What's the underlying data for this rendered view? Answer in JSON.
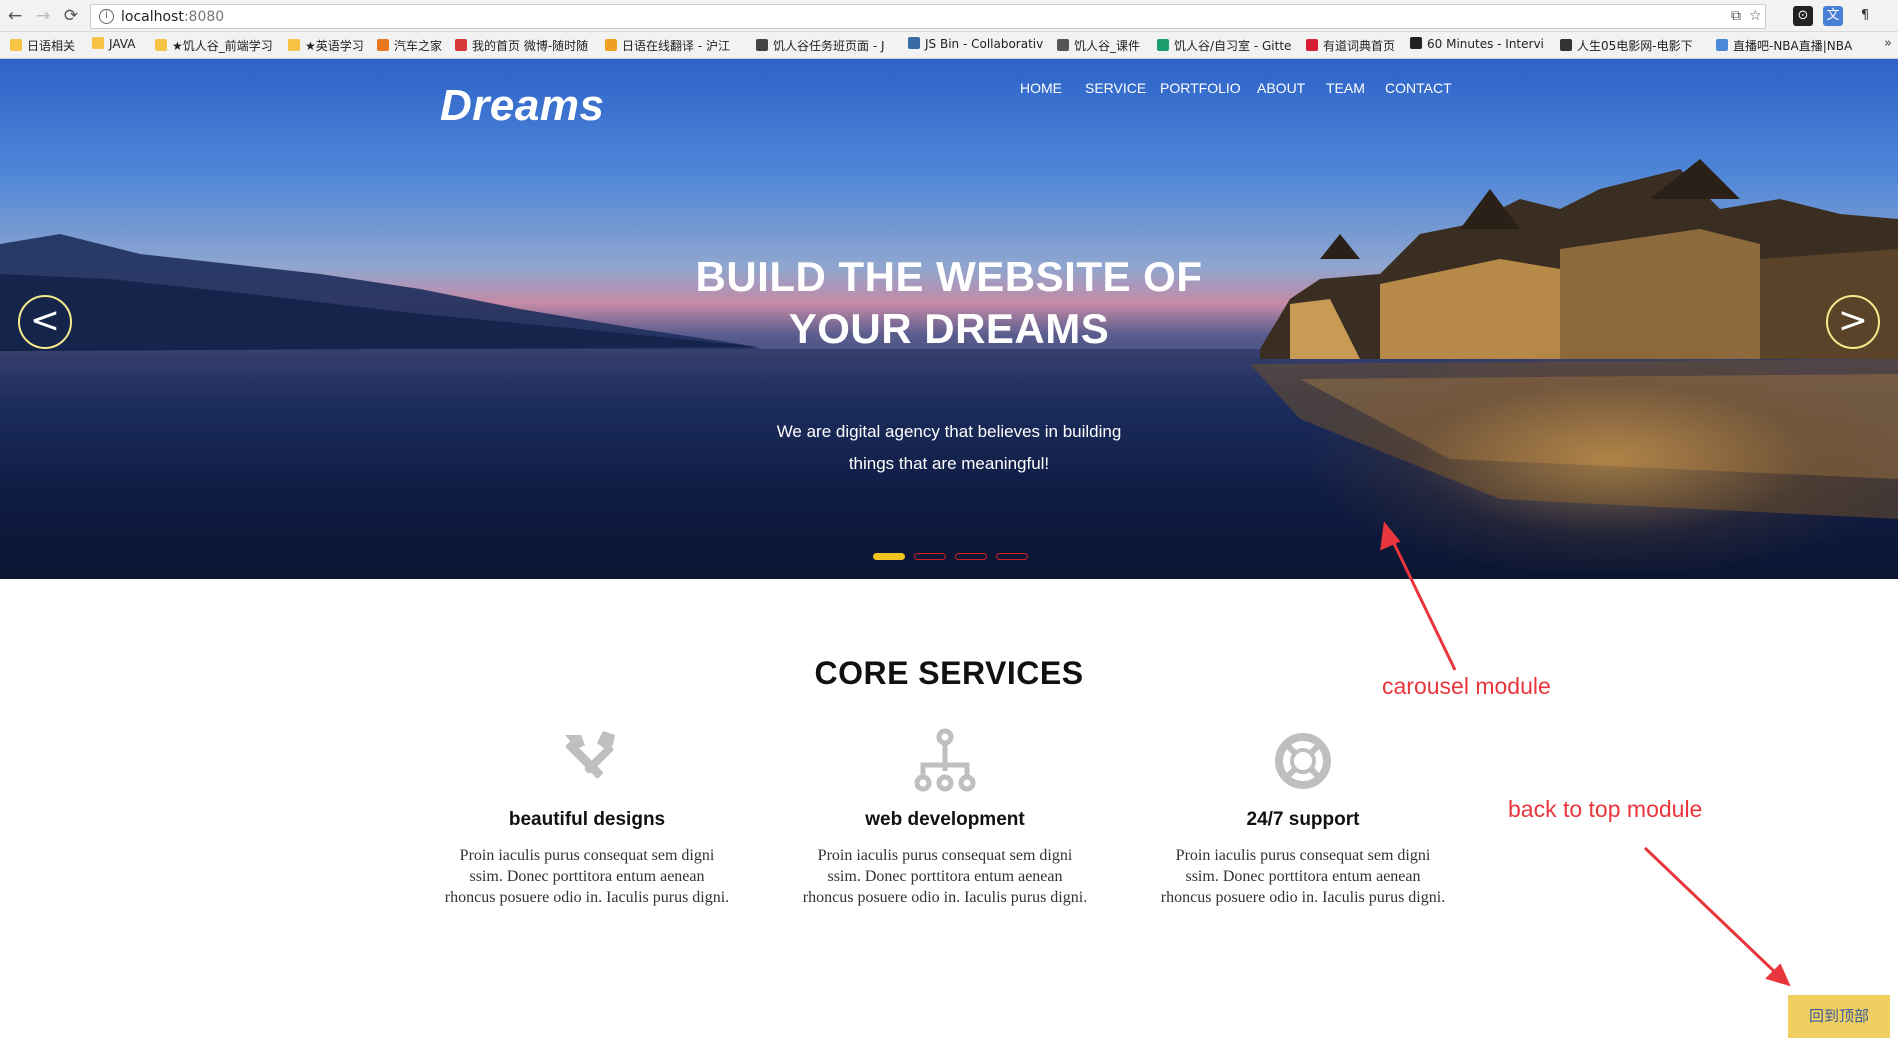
{
  "browser": {
    "url_host": "localhost",
    "url_port": ":8080",
    "bookmarks": [
      {
        "label": "日语相关",
        "icon_color": "#f6c343"
      },
      {
        "label": "JAVA",
        "icon_color": "#f6c343"
      },
      {
        "label": "★饥人谷_前端学习",
        "icon_color": "#f6c343"
      },
      {
        "label": "★英语学习",
        "icon_color": "#f6c343"
      },
      {
        "label": "汽车之家",
        "icon_color": "#e8771f"
      },
      {
        "label": "我的首页 微博-随时随",
        "icon_color": "#d93838"
      },
      {
        "label": "日语在线翻译 - 沪江",
        "icon_color": "#f0a020"
      },
      {
        "label": "饥人谷任务班页面 - J",
        "icon_color": "#444444"
      },
      {
        "label": "JS Bin - Collaborativ",
        "icon_color": "#3b6ba5"
      },
      {
        "label": "饥人谷_课件",
        "icon_color": "#555555"
      },
      {
        "label": "饥人谷/自习室 - Gitte",
        "icon_color": "#1e9e6e"
      },
      {
        "label": "有道词典首页",
        "icon_color": "#d81e30"
      },
      {
        "label": "60 Minutes - Intervi",
        "icon_color": "#222222"
      },
      {
        "label": "人生05电影网-电影下",
        "icon_color": "#333333"
      },
      {
        "label": "直播吧-NBA直播|NBA",
        "icon_color": "#4a88d8"
      }
    ],
    "more_label": "»"
  },
  "site": {
    "brand": "Dreams",
    "nav": [
      "HOME",
      "SERVICE",
      "PORTFOLIO",
      "ABOUT",
      "TEAM",
      "CONTACT"
    ],
    "hero": {
      "title_line1": "BUILD THE WEBSITE OF",
      "title_line2": "YOUR DREAMS",
      "subtitle_line1": "We are digital agency that believes in building",
      "subtitle_line2": "things that are meaningful!",
      "prev_label": "<",
      "next_label": ">",
      "slide_count": 4,
      "active_slide": 1
    },
    "services": {
      "title": "CORE SERVICES",
      "items": [
        {
          "icon": "tools-icon",
          "title": "beautiful designs",
          "text": "Proin iaculis purus consequat sem digni ssim. Donec porttitora entum aenean rhoncus posuere odio in. Iaculis purus digni."
        },
        {
          "icon": "sitemap-icon",
          "title": "web development",
          "text": "Proin iaculis purus consequat sem digni ssim. Donec porttitora entum aenean rhoncus posuere odio in. Iaculis purus digni."
        },
        {
          "icon": "lifebuoy-icon",
          "title": "24/7 support",
          "text": "Proin iaculis purus consequat sem digni ssim. Donec porttitora entum aenean rhoncus posuere odio in. Iaculis purus digni."
        }
      ]
    },
    "back_to_top": "回到顶部"
  },
  "annotations": {
    "carousel": "carousel module",
    "back_to_top": "back to top module"
  },
  "colors": {
    "accent_yellow": "#f3c41e",
    "indicator_red": "#d32020",
    "annotation_red": "#e8363c",
    "backtop_bg": "#f0cf61",
    "backtop_text": "#3b5d9b"
  }
}
